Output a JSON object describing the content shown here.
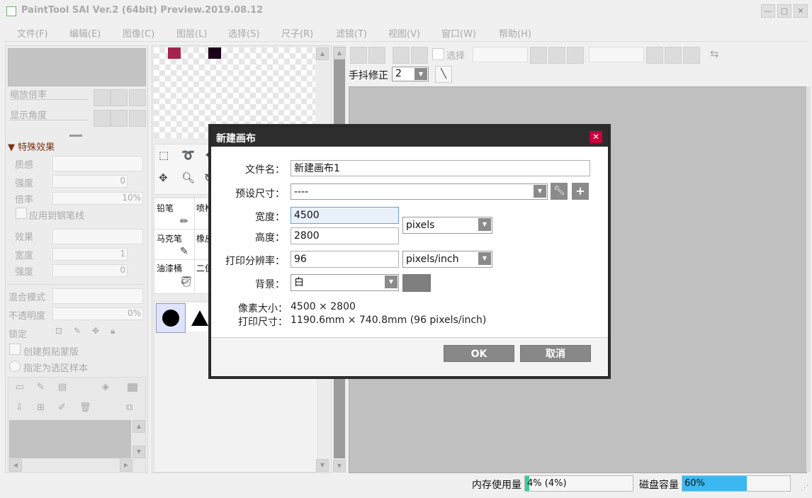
{
  "window": {
    "title": "PaintTool SAI Ver.2 (64bit) Preview.2019.08.12",
    "minimize": "—",
    "maximize": "□",
    "close": "✕"
  },
  "menubar": [
    "文件(F)",
    "编辑(E)",
    "图像(C)",
    "图层(L)",
    "选择(S)",
    "尺子(R)",
    "滤镜(T)",
    "视图(V)",
    "窗口(W)",
    "帮助(H)"
  ],
  "navigator": {
    "zoom_label": "缩放倍率",
    "angle_label": "显示角度"
  },
  "effects": {
    "header": "特殊效果",
    "texture_label": "质感",
    "strength_label": "强度",
    "strength_value": "0",
    "scale_label": "倍率",
    "scale_value": "10%",
    "apply_pen": "应用到钢笔线",
    "effect_label": "效果",
    "width_label": "宽度",
    "width_value": "1",
    "strength2_label": "强度",
    "strength2_value": "0"
  },
  "layer": {
    "blend_label": "混合模式",
    "opacity_label": "不透明度",
    "opacity_value": "0%",
    "lock_label": "锁定",
    "clip_label": "创建剪贴蒙版",
    "selection_source_label": "指定为选区样本"
  },
  "colors": {
    "swatch1": "#a3234f",
    "swatch2": "#1a0018"
  },
  "tools": [
    "铅笔",
    "喷枪",
    "马克笔",
    "橡皮",
    "油漆桶",
    "二值"
  ],
  "toolbar": {
    "select_label": "选择",
    "stabilizer_label": "手抖修正",
    "stabilizer_value": "2"
  },
  "dialog": {
    "title": "新建画布",
    "close": "✕",
    "filename_label": "文件名：",
    "filename_value": "新建画布1",
    "preset_label": "预设尺寸：",
    "preset_value": "----",
    "width_label": "宽度：",
    "width_value": "4500",
    "height_label": "高度：",
    "height_value": "2800",
    "unit_value": "pixels",
    "dpi_label": "打印分辨率：",
    "dpi_value": "96",
    "dpi_unit": "pixels/inch",
    "bg_label": "背景：",
    "bg_value": "白",
    "bg_color": "#7f7f7f",
    "pixel_size_label": "像素大小：",
    "pixel_size_value": "4500 × 2800",
    "print_size_label": "打印尺寸：",
    "print_size_value": "1190.6mm × 740.8mm (96 pixels/inch)",
    "ok": "OK",
    "cancel": "取消"
  },
  "status": {
    "memory_label": "内存使用量",
    "memory_value": "4% (4%)",
    "memory_fraction": 0.04,
    "disk_label": "磁盘容量",
    "disk_value": "60%",
    "disk_fraction": 0.6,
    "memory_color": "#3cc7a0",
    "disk_color": "#3cb8f0"
  }
}
